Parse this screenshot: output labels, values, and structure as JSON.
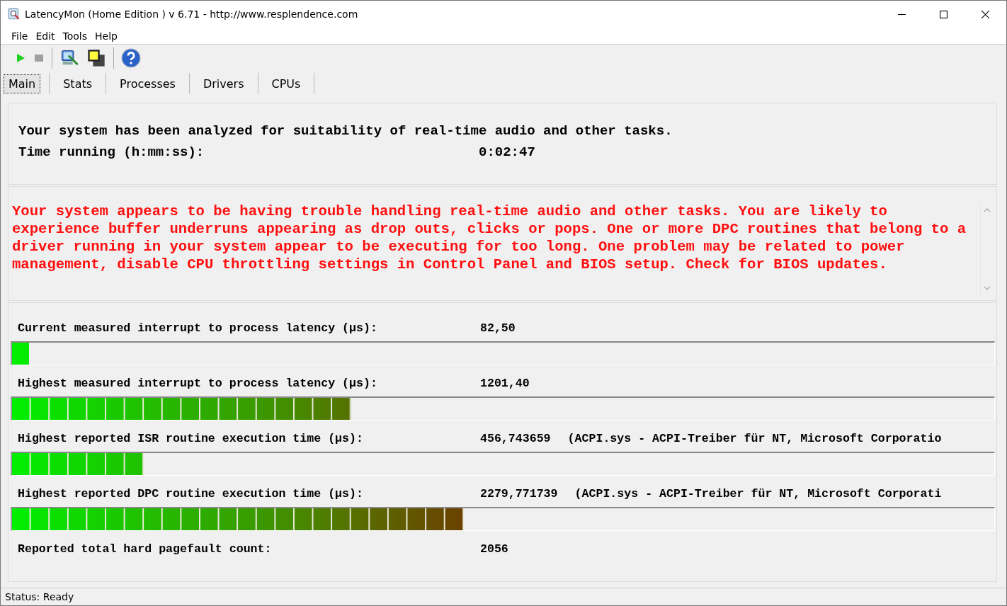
{
  "window": {
    "title": "LatencyMon  (Home Edition )  v 6.71 - http://www.resplendence.com"
  },
  "menu": [
    {
      "label": "File"
    },
    {
      "label": "Edit"
    },
    {
      "label": "Tools"
    },
    {
      "label": "Help"
    }
  ],
  "toolbar": {
    "play_enabled": true,
    "stop_enabled": false
  },
  "tabs": [
    {
      "label": "Main",
      "selected": true
    },
    {
      "label": "Stats",
      "selected": false
    },
    {
      "label": "Processes",
      "selected": false
    },
    {
      "label": "Drivers",
      "selected": false
    },
    {
      "label": "CPUs",
      "selected": false
    }
  ],
  "summary": {
    "headline": "Your system has been analyzed for suitability of real-time audio and other tasks.",
    "time_label": "Time running (h:mm:ss):",
    "time_value": "0:02:47"
  },
  "verdict": {
    "text": "Your system appears to be having trouble handling real-time audio and other tasks. You are likely to experience buffer underruns appearing as drop outs, clicks or pops. One or more DPC routines that belong to a driver running in your system appear to be executing for too long. One problem may be related to power management, disable CPU throttling settings in Control Panel and BIOS setup. Check for BIOS updates.",
    "alert": true
  },
  "measurements": [
    {
      "kind": "meter",
      "label": "Current measured interrupt to process latency (µs):",
      "value": "82,50",
      "level": 0.017
    },
    {
      "kind": "meter",
      "label": "Highest measured interrupt to process latency (µs):",
      "value": "1201,40",
      "level": 0.339
    },
    {
      "kind": "meter",
      "label": "Highest reported ISR routine execution time (µs):",
      "value": "456,743659",
      "detail": "(ACPI.sys - ACPI-Treiber für NT, Microsoft Corporatio",
      "level": 0.137
    },
    {
      "kind": "meter",
      "label": "Highest reported DPC routine execution time (µs):",
      "value": "2279,771739",
      "detail": "(ACPI.sys - ACPI-Treiber für NT, Microsoft Corporati",
      "level": 0.454
    },
    {
      "kind": "count",
      "label": "Reported total hard pagefault count:",
      "value": "2056"
    }
  ],
  "status_bar": {
    "text": "Status: Ready"
  }
}
